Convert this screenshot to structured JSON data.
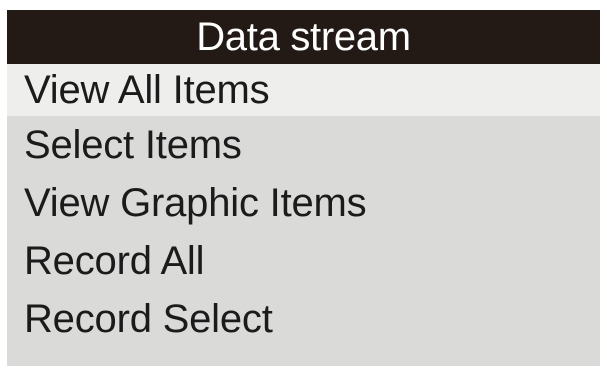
{
  "header": {
    "title": "Data stream"
  },
  "menu": {
    "selected_index": 0,
    "items": [
      {
        "label": "View All Items"
      },
      {
        "label": "Select Items"
      },
      {
        "label": "View Graphic Items"
      },
      {
        "label": "Record All"
      },
      {
        "label": "Record Select"
      }
    ]
  },
  "colors": {
    "title_bar": "#231a16",
    "screen_background": "#dadad8",
    "highlight": "#eeeeec",
    "text": "#1b1b1b"
  }
}
